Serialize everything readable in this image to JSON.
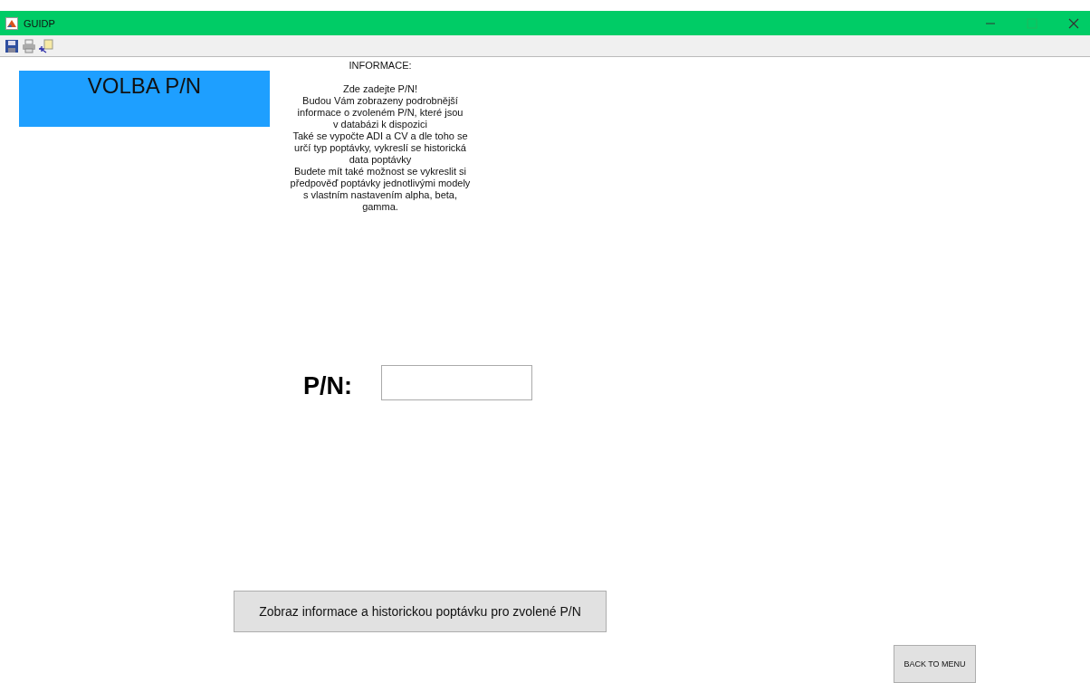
{
  "window": {
    "title": "GUIDP"
  },
  "header": {
    "label": "VOLBA P/N"
  },
  "info": {
    "heading": "INFORMACE:",
    "lines": [
      "Zde zadejte P/N!",
      "Budou Vám zobrazeny podrobnější",
      "informace o zvoleném P/N, které jsou",
      "v databázi k dispozici",
      "Také se vypočte ADI a CV a dle toho se",
      "určí typ poptávky, vykreslí se historická",
      "data poptávky",
      "Budete mít také možnost se vykreslit si",
      "předpověď poptávky jednotlivými modely",
      "s vlastním nastavením alpha, beta,",
      "gamma."
    ]
  },
  "pn_field": {
    "label": "P/N:"
  },
  "show_button": {
    "label": "Zobraz informace a historickou poptávku pro zvolené P/N"
  },
  "back_button": {
    "label": "BACK TO MENU"
  }
}
